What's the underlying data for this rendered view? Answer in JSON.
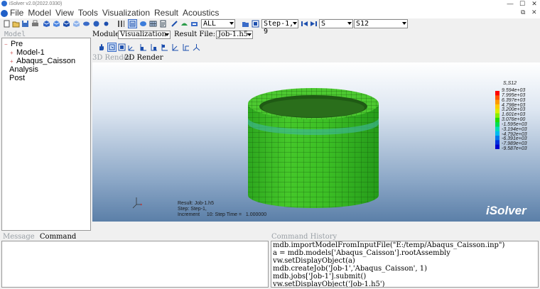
{
  "window": {
    "title": "iSolver v2.0(2022.0330)",
    "minimize_glyph": "—",
    "maximize_glyph": "☐",
    "close_glyph": "✕"
  },
  "menubar": {
    "items": [
      "File",
      "Model",
      "View",
      "Tools",
      "Visualization",
      "Result",
      "Acoustics"
    ],
    "mdi_restore_glyph": "⧉",
    "mdi_close_glyph": "✕"
  },
  "toolbar": {
    "filter_combo": "ALL",
    "step_combo": "Step-1, 9",
    "variable_combo": "S",
    "component_combo": "S12"
  },
  "left_panel": {
    "label": "Model",
    "tree": {
      "pre": "Pre",
      "model1": "Model-1",
      "abaqus": "Abaqus_Caisson",
      "analysis": "Analysis",
      "post": "Post"
    }
  },
  "module_row": {
    "module_label": "Module:",
    "module_value": "Visualization",
    "result_label": "Result File:",
    "result_value": "Job-1.h5"
  },
  "render_tabs": {
    "tab_3d": "3D Render",
    "tab_2d": "2D Render"
  },
  "viewport": {
    "legend_title": "S,S12",
    "legend_values": [
      "9.594e+03",
      "7.995e+03",
      "6.397e+03",
      "4.798e+03",
      "3.200e+03",
      "1.601e+03",
      "3.076e+00",
      "-1.595e+03",
      "-3.194e+03",
      "-4.792e+03",
      "-6.391e+03",
      "-7.989e+03",
      "-9.587e+03"
    ],
    "legend_colors": [
      "#ff0000",
      "#ff5500",
      "#ff9900",
      "#ffcc00",
      "#ddee00",
      "#88ee00",
      "#22dd00",
      "#00dd55",
      "#00ddbb",
      "#00bbee",
      "#0077ee",
      "#0033dd",
      "#0000cc"
    ],
    "info_result": "Result: Job-1.h5",
    "info_step": "Step: Step-1,",
    "info_increment": "Increment     10: Step Time =   1.000000",
    "brand": "iSolver"
  },
  "bottom": {
    "message_tab": "Message",
    "command_tab": "Command",
    "history_label": "Command History",
    "history": [
      "mdb.importModelFromInputFile(\"E:/temp/Abaqus_Caisson.inp\")",
      "a = mdb.models['Abaqus_Caisson'].rootAssembly",
      "vw.setDisplayObject(a)",
      "mdb.createJob('Job-1','Abaqus_Caisson', 1)",
      "mdb.jobs['Job-1'].submit()",
      "vw.setDisplayObject('Job-1.h5')"
    ]
  }
}
